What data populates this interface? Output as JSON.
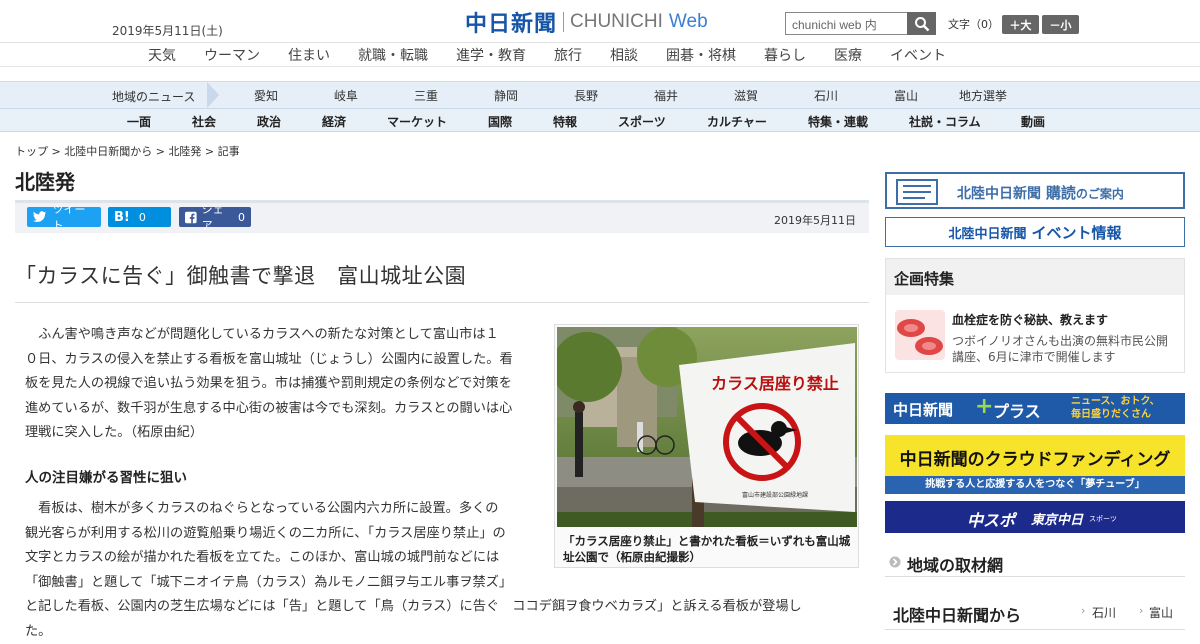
{
  "header": {
    "date": "2019年5月11日(土)",
    "logo_main": "中日新聞",
    "logo_sub1": "CHUNICHI",
    "logo_sub2": "Web",
    "search_placeholder": "chunichi web 内",
    "font_label": "文字（0）",
    "font_large": "＋大",
    "font_small": "－小"
  },
  "category_nav": [
    "天気",
    "ウーマン",
    "住まい",
    "就職・転職",
    "進学・教育",
    "旅行",
    "相談",
    "囲碁・将棋",
    "暮らし",
    "医療",
    "イベント"
  ],
  "region_nav": {
    "label": "地域のニュース",
    "items": [
      "愛知",
      "岐阜",
      "三重",
      "静岡",
      "長野",
      "福井",
      "滋賀",
      "石川",
      "富山",
      "地方選挙"
    ]
  },
  "section_nav": [
    "一面",
    "社会",
    "政治",
    "経済",
    "マーケット",
    "国際",
    "特報",
    "スポーツ",
    "カルチャー",
    "特集・連載",
    "社説・コラム",
    "動画"
  ],
  "breadcrumb": {
    "top": "トップ",
    "sep": " > ",
    "parent": "北陸中日新聞から",
    "section": "北陸発",
    "current": "記事"
  },
  "page_title": "北陸発",
  "share": {
    "tweet": "ツイート",
    "hatena_count": "0",
    "facebook": "シェア",
    "facebook_count": "0",
    "date": "2019年5月11日"
  },
  "article": {
    "headline": "「カラスに告ぐ」御触書で撃退　富山城址公園",
    "lead_lines": [
      "　ふん害や鳴き声などが問題化しているカラスへの新たな対策として富山市は１",
      "０日、カラスの侵入を禁止する看板を富山城址（じょうし）公園内に設置した。看",
      "板を見た人の視線で追い払う効果を狙う。市は捕獲や罰則規定の条例などで対策を",
      "進めているが、数千羽が生息する中心街の被害は今でも深刻。カラスとの闘いは心",
      "理戦に突入した。（柘原由紀）"
    ],
    "subhead": "人の注目嫌がる習性に狙い",
    "body_lines": [
      "　看板は、樹木が多くカラスのねぐらとなっている公園内六カ所に設置。多くの",
      "観光客らが利用する松川の遊覧船乗り場近くの二カ所に、「カラス居座り禁止」の",
      "文字とカラスの絵が描かれた看板を立てた。このほか、富山城の城門前などには",
      "「御触書」と題して「城下ニオイテ鳥（カラス）為ルモノ二餌ヲ与エル事ヲ禁ズ」",
      "と記した看板、公園内の芝生広場などには「告」と題して「鳥（カラス）に告ぐ　ココデ餌ヲ食ウベカラズ」と訴える看板が登場し",
      "た。"
    ],
    "photo_sign_title": "カラス居座り禁止",
    "photo_sign_footer": "富山市建設部公園緑地課",
    "caption": "「カラス居座り禁止」と書かれた看板＝いずれも富山城址公園で（柘原由紀撮影）"
  },
  "sidebar": {
    "subscribe": "北陸中日新聞 購読のご案内",
    "subscribe_main": "北陸中日新聞",
    "subscribe_strong": "購読",
    "subscribe_tail": "のご案内",
    "event_main": "北陸中日新聞",
    "event_strong": "イベント情報",
    "kikaku_title": "企画特集",
    "kikaku_item_title": "血栓症を防ぐ秘訣、教えます",
    "kikaku_item_text": "つボイノリオさんも出演の無料市民公開講座、6月に津市で開催します",
    "plus_label": "中日新聞",
    "plus_label2": "プラス",
    "plus_tag1": "ニュース、おトク、",
    "plus_tag2": "毎日盛りだくさん",
    "cf_title": "中日新聞のクラウドファンディング",
    "cf_sub": "挑戦する人と応援する人をつなぐ「夢チューブ」",
    "sports_main": "中スポ",
    "sports_sub": "東京中日",
    "sports_tag": "スポーツ",
    "region_link": "地域の取材網",
    "hokuriku_link": "北陸中日新聞から",
    "hokuriku_tabs": [
      "石川",
      "富山"
    ]
  },
  "colors": {
    "brand": "#1655a8",
    "twitter": "#1da1f2",
    "hatena": "#008fde",
    "facebook": "#3b5998",
    "nav_bg": "#e6eef7",
    "cf_yellow": "#f7e32a",
    "sports_navy": "#1c2a8c"
  }
}
